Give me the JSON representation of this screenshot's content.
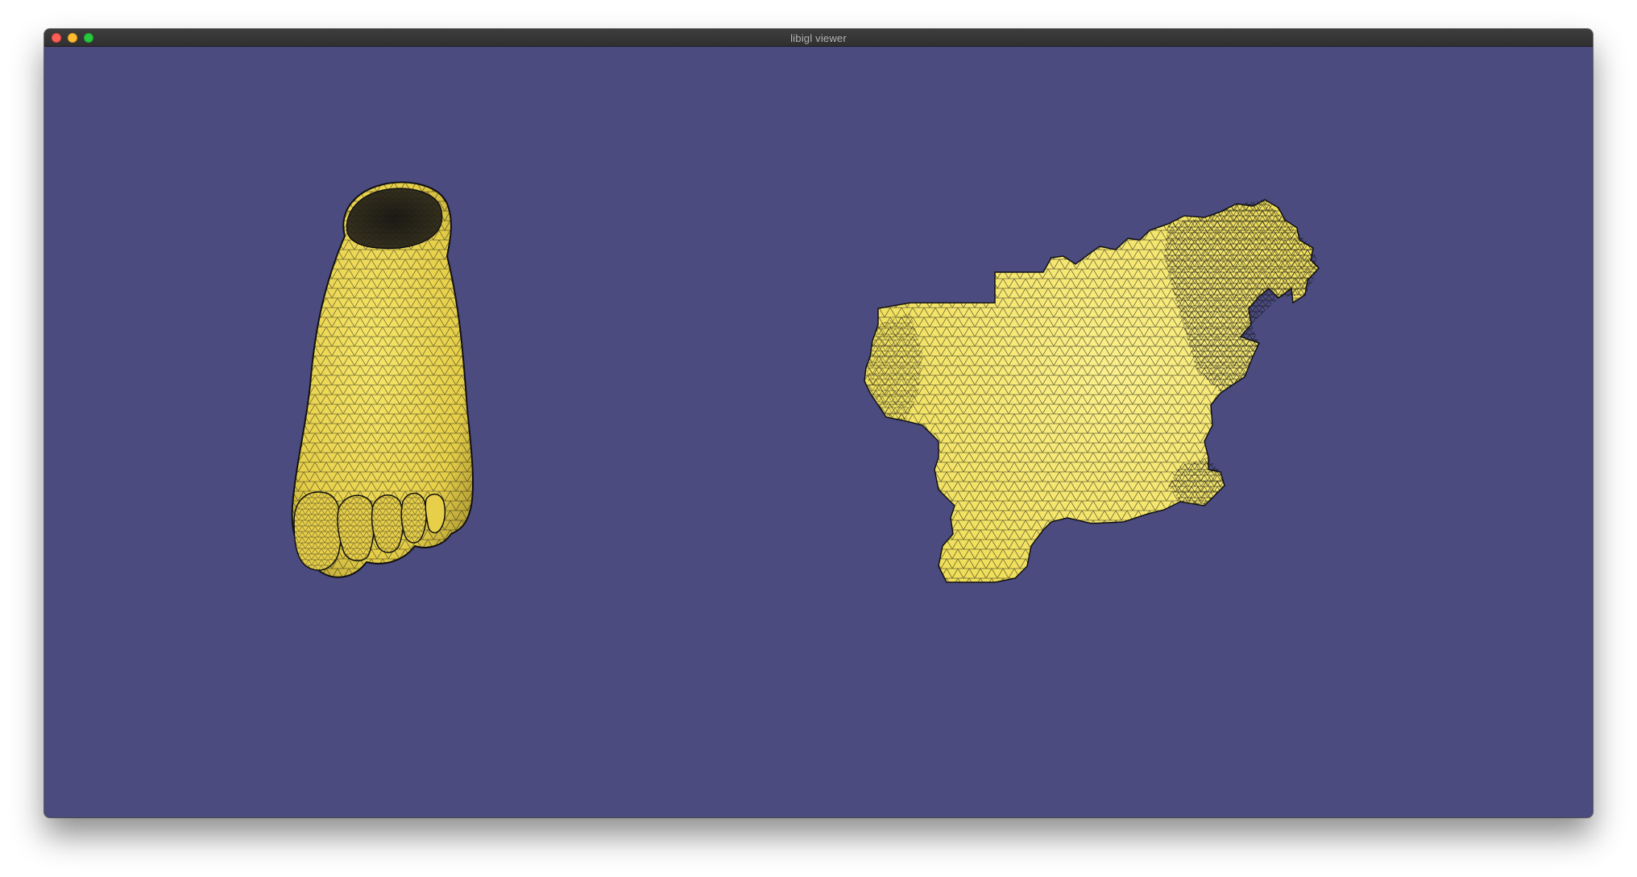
{
  "window": {
    "title": "libigl viewer"
  },
  "colors": {
    "background": "#4b4b80",
    "mesh_fill": "#f2e15a",
    "mesh_shadow": "#b9a93a",
    "wire": "#111111",
    "titlebar": "#363636",
    "title_text": "#b3b3b3"
  },
  "scene": {
    "left_mesh": "foot-3d-mesh",
    "right_mesh": "foot-uv-parameterization"
  },
  "icons": {
    "close": "close-traffic-light-icon",
    "minimize": "minimize-traffic-light-icon",
    "maximize": "maximize-traffic-light-icon"
  }
}
